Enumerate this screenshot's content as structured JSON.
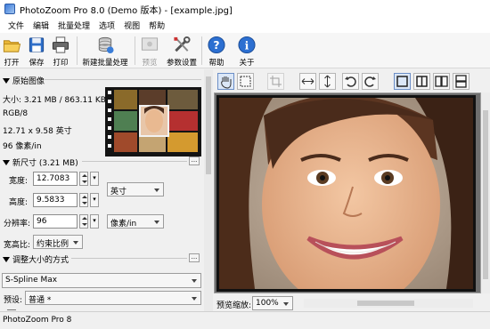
{
  "window": {
    "title": "PhotoZoom Pro 8.0 (Demo 版本) - [example.jpg]"
  },
  "menu": [
    "文件",
    "编辑",
    "批量处理",
    "选项",
    "视图",
    "帮助"
  ],
  "toolbar": {
    "open": "打开",
    "save": "保存",
    "print": "打印",
    "batch": "新建批量处理",
    "preview": "预览",
    "settings": "参数设置",
    "help": "帮助",
    "about": "关于"
  },
  "original": {
    "header": "原始图像",
    "size": "大小: 3.21 MB / 863.11 KB",
    "mode": "RGB/8",
    "dimensions": "12.71 x 9.58 英寸",
    "resolution": "96 像素/in"
  },
  "new_size": {
    "header": "新尺寸 (3.21 MB)",
    "width_label": "宽度:",
    "width_value": "12.7083",
    "height_label": "高度:",
    "height_value": "9.5833",
    "unit": "英寸",
    "resolution_label": "分辨率:",
    "resolution_value": "96",
    "resolution_unit": "像素/in",
    "aspect_label": "宽高比:",
    "aspect_value": "约束比例"
  },
  "resize_method": {
    "header": "调整大小的方式",
    "method": "S-Spline Max",
    "preset_label": "预设:",
    "preset_value": "普通 *"
  },
  "preview_bottom": {
    "zoom_label": "预览缩放:",
    "zoom_value": "100%"
  },
  "status": {
    "text": "PhotoZoom Pro 8"
  }
}
